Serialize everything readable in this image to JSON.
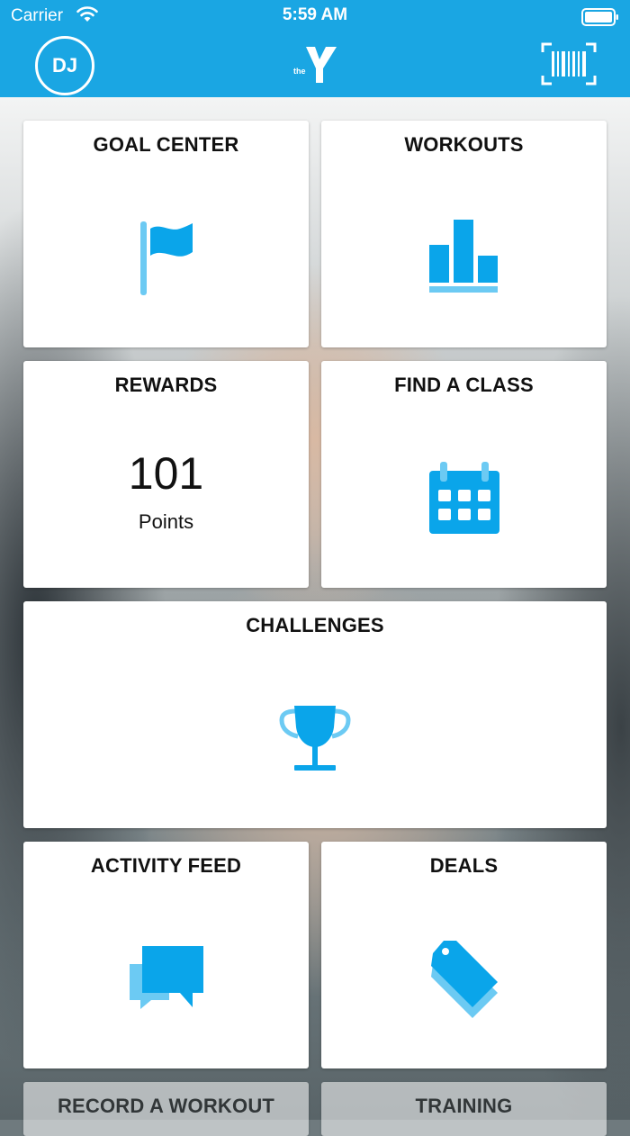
{
  "status_bar": {
    "carrier": "Carrier",
    "time": "5:59 AM"
  },
  "header": {
    "avatar_initials": "DJ",
    "logo_text": "the"
  },
  "tiles": {
    "goal_center": {
      "title": "GOAL CENTER",
      "icon": "flag-icon"
    },
    "workouts": {
      "title": "WORKOUTS",
      "icon": "bar-chart-icon"
    },
    "rewards": {
      "title": "REWARDS",
      "points": "101",
      "points_label": "Points"
    },
    "find_a_class": {
      "title": "FIND A CLASS",
      "icon": "calendar-icon"
    },
    "challenges": {
      "title": "CHALLENGES",
      "icon": "trophy-icon"
    },
    "activity_feed": {
      "title": "ACTIVITY FEED",
      "icon": "chat-bubbles-icon"
    },
    "deals": {
      "title": "DEALS",
      "icon": "price-tag-icon"
    },
    "record_a_workout": {
      "title": "RECORD A WORKOUT"
    },
    "training": {
      "title": "TRAINING"
    }
  },
  "colors": {
    "brand": "#1aa6e3",
    "icon_primary": "#0aa5ea",
    "icon_secondary": "#6ccaf3"
  }
}
